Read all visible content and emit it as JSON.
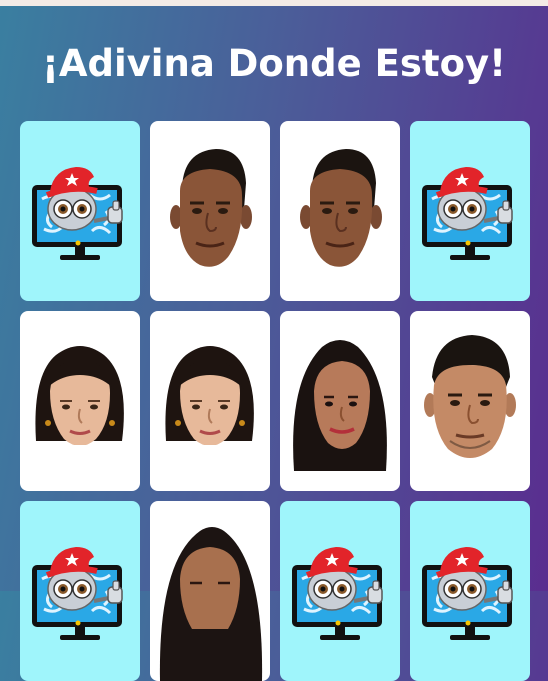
{
  "title": "¡Adivina Donde Estoy!",
  "colors": {
    "card_back": "#9ff5fb",
    "card_front": "#ffffff"
  },
  "cards": [
    {
      "state": "hidden",
      "content": "robot-monitor-icon"
    },
    {
      "state": "revealed",
      "content": "man-face-photo"
    },
    {
      "state": "revealed",
      "content": "man-face-photo"
    },
    {
      "state": "hidden",
      "content": "robot-monitor-icon"
    },
    {
      "state": "revealed",
      "content": "woman-face-photo-1"
    },
    {
      "state": "revealed",
      "content": "woman-face-photo-1"
    },
    {
      "state": "revealed",
      "content": "woman-face-photo-2"
    },
    {
      "state": "revealed",
      "content": "man-face-photo-2"
    },
    {
      "state": "hidden",
      "content": "robot-monitor-icon"
    },
    {
      "state": "revealed",
      "content": "woman-face-photo-3"
    },
    {
      "state": "hidden",
      "content": "robot-monitor-icon"
    },
    {
      "state": "hidden",
      "content": "robot-monitor-icon"
    }
  ]
}
